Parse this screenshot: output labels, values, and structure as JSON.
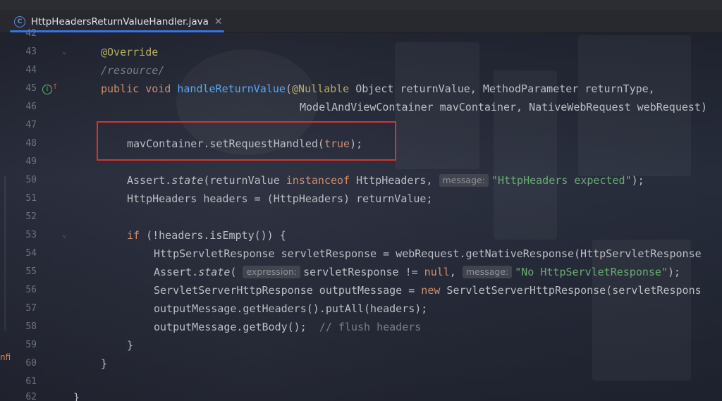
{
  "tab": {
    "filename": "HttpHeadersReturnValueHandler.java",
    "close": "✕",
    "class_icon": "C"
  },
  "side_fragment": "nfi",
  "lines": [
    {
      "num": "42",
      "text": ""
    },
    {
      "num": "43",
      "text": "@Override"
    },
    {
      "num": "44",
      "text": "/resource/"
    },
    {
      "num": "45",
      "text": "public void handleReturnValue(@Nullable Object returnValue, MethodParameter returnType,"
    },
    {
      "num": "46",
      "text": "ModelAndViewContainer mavContainer, NativeWebRequest webRequest)"
    },
    {
      "num": "47",
      "text": ""
    },
    {
      "num": "48",
      "text": "mavContainer.setRequestHandled(true);"
    },
    {
      "num": "49",
      "text": ""
    },
    {
      "num": "50",
      "text": "Assert.state(returnValue instanceof HttpHeaders, message: \"HttpHeaders expected\");"
    },
    {
      "num": "51",
      "text": "HttpHeaders headers = (HttpHeaders) returnValue;"
    },
    {
      "num": "52",
      "text": ""
    },
    {
      "num": "53",
      "text": "if (!headers.isEmpty()) {"
    },
    {
      "num": "54",
      "text": "HttpServletResponse servletResponse = webRequest.getNativeResponse(HttpServletResponse"
    },
    {
      "num": "55",
      "text": "Assert.state( expression: servletResponse != null, message: \"No HttpServletResponse\");"
    },
    {
      "num": "56",
      "text": "ServletServerHttpResponse outputMessage = new ServletServerHttpResponse(servletRespons"
    },
    {
      "num": "57",
      "text": "outputMessage.getHeaders().putAll(headers);"
    },
    {
      "num": "58",
      "text": "outputMessage.getBody();  // flush headers"
    },
    {
      "num": "59",
      "text": "}"
    },
    {
      "num": "60",
      "text": "}"
    },
    {
      "num": "61",
      "text": ""
    },
    {
      "num": "62",
      "text": "}"
    }
  ],
  "tokens": {
    "l43": "@Override",
    "l44": "/resource/",
    "l45_kw": "public void ",
    "l45_fn": "handleReturnValue",
    "l45_p1": "(",
    "l45_ann": "@Nullable",
    "l45_rest": " Object returnValue, MethodParameter returnType,",
    "l46": "ModelAndViewContainer mavContainer, NativeWebRequest webRequest)",
    "l48_a": "mavContainer.setRequestHandled(",
    "l48_kw": "true",
    "l48_b": ");",
    "l50_a": "Assert.",
    "l50_it": "state",
    "l50_b": "(returnValue ",
    "l50_kw": "instanceof",
    "l50_c": " HttpHeaders, ",
    "l50_hint": "message:",
    "l50_str": "\"HttpHeaders expected\"",
    "l50_d": ");",
    "l51": "HttpHeaders headers = (HttpHeaders) returnValue;",
    "l53_kw": "if",
    "l53_rest": " (!headers.isEmpty()) {",
    "l54": "HttpServletResponse servletResponse = webRequest.getNativeResponse(HttpServletResponse",
    "l55_a": "Assert.",
    "l55_it": "state",
    "l55_b": "(",
    "l55_hint1": "expression:",
    "l55_c": "servletResponse != ",
    "l55_kw": "null",
    "l55_d": ", ",
    "l55_hint2": "message:",
    "l55_str": "\"No HttpServletResponse\"",
    "l55_e": ");",
    "l56_a": "ServletServerHttpResponse outputMessage = ",
    "l56_kw": "new",
    "l56_b": " ServletServerHttpResponse(servletRespons",
    "l57": "outputMessage.getHeaders().putAll(headers);",
    "l58_a": "outputMessage.getBody();  ",
    "l58_cmt": "// flush headers",
    "l59": "}",
    "l60": "}",
    "l62": "}"
  },
  "colors": {
    "keyword": "#cf8e6d",
    "function": "#56a8f5",
    "string": "#6aab73",
    "annotation": "#b3ae60",
    "highlight_box": "#d8322e",
    "tab_underline": "#3574f0"
  }
}
